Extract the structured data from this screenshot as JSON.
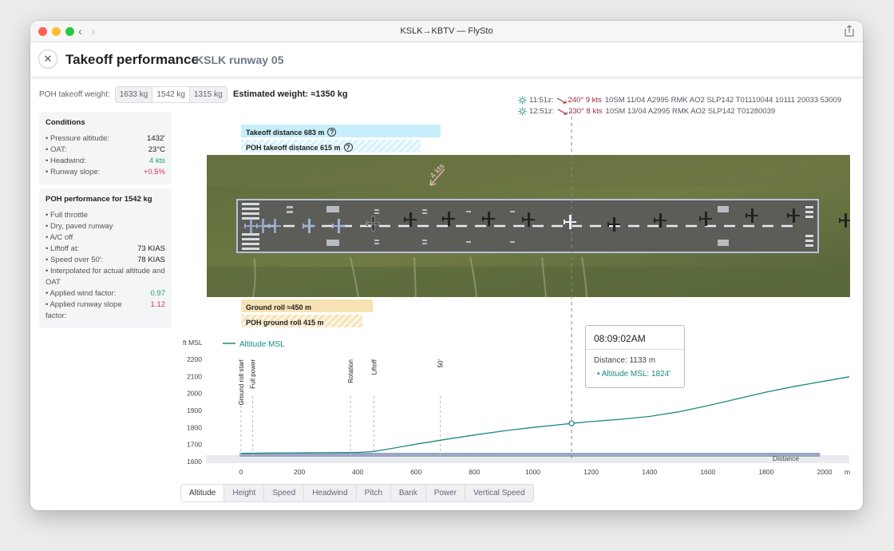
{
  "window": {
    "title": "KSLK→KBTV — FlySto"
  },
  "header": {
    "title": "Takeoff performance",
    "subtitle": "KSLK runway 05",
    "close_glyph": "✕"
  },
  "weights": {
    "label": "POH takeoff weight:",
    "options": [
      "1633 kg",
      "1542 kg",
      "1315 kg"
    ],
    "selected": "1542 kg",
    "estimated": "Estimated weight: ≈1350 kg"
  },
  "conditions": {
    "title": "Conditions",
    "rows": [
      {
        "label": "• Pressure altitude:",
        "value": "1432'"
      },
      {
        "label": "• OAT:",
        "value": "23°C"
      },
      {
        "label": "• Headwind:",
        "value": "4 kts"
      },
      {
        "label": "• Runway slope:",
        "value": "+0.5%"
      }
    ]
  },
  "poh": {
    "title": "POH performance for 1542 kg",
    "items": [
      "• Full throttle",
      "• Dry, paved runway",
      "• A/C off"
    ],
    "rows": [
      {
        "label": "• Liftoff at:",
        "value": "73 KIAS"
      },
      {
        "label": "• Speed over 50':",
        "value": "78 KIAS"
      }
    ],
    "note": "• Interpolated for actual altitude and OAT",
    "wind_factor_label": "• Applied wind factor:",
    "wind_factor_value": "0.97",
    "slope_factor_label": "• Applied runway slope factor:",
    "slope_factor_value": "1.12"
  },
  "metars": [
    {
      "time": "11:51z:",
      "wind": "240° 9 kts",
      "text": "10SM 11/04 A2995 RMK AO2 SLP142 T01110044 10111 20033 53009"
    },
    {
      "time": "12:51z:",
      "wind": "230° 8 kts",
      "text": "10SM 13/04 A2995 RMK AO2 SLP142 T01280039"
    }
  ],
  "distances": {
    "takeoff": "Takeoff distance 683 m",
    "poh_takeoff": "POH takeoff distance 615 m",
    "ground_roll": "Ground roll ≈450 m",
    "poh_ground_roll": "POH ground roll 415 m",
    "help_glyph": "?"
  },
  "runway": {
    "wind_label": "4 kts"
  },
  "tooltip": {
    "time": "08:09:02AM",
    "distance": "Distance: 1133 m",
    "altitude": "• Altitude MSL: 1824'"
  },
  "chart_data": {
    "type": "line",
    "ylabel": "ft MSL",
    "xlabel": "m",
    "xlim": [
      0,
      2000
    ],
    "ylim": [
      1600,
      2200
    ],
    "xticks": [
      0,
      200,
      400,
      600,
      800,
      1000,
      1200,
      1400,
      1600,
      1800,
      2000
    ],
    "yticks": [
      1600,
      1700,
      1800,
      1900,
      2000,
      2100,
      2200
    ],
    "legend": "top-left",
    "series": [
      {
        "name": "Altitude MSL",
        "color": "#1a8a80",
        "x": [
          0,
          100,
          200,
          300,
          400,
          450,
          500,
          600,
          700,
          800,
          900,
          1000,
          1100,
          1133,
          1200,
          1300,
          1400,
          1500,
          1600,
          1700,
          1800,
          1900,
          2000,
          2085
        ],
        "y": [
          1648,
          1650,
          1651,
          1652,
          1654,
          1658,
          1672,
          1702,
          1730,
          1756,
          1780,
          1800,
          1818,
          1824,
          1835,
          1848,
          1865,
          1892,
          1928,
          1968,
          2008,
          2042,
          2072,
          2098
        ]
      }
    ],
    "events": [
      {
        "label": "Ground roll start",
        "x": 0
      },
      {
        "label": "Full power",
        "x": 40
      },
      {
        "label": "Rotation",
        "x": 375
      },
      {
        "label": "Liftoff",
        "x": 455
      },
      {
        "label": "50'",
        "x": 683
      }
    ],
    "runway_band_label": "Distance",
    "runway_band_x": [
      0,
      1990
    ],
    "cursor_x": 1133
  },
  "tabs": [
    "Altitude",
    "Height",
    "Speed",
    "Headwind",
    "Pitch",
    "Bank",
    "Power",
    "Vertical Speed"
  ],
  "selected_tab": "Altitude",
  "colors": {
    "accent": "#1a8a80",
    "wind_red": "#9a2a3c",
    "positive": "#21a06b",
    "negative": "#d9305b"
  }
}
